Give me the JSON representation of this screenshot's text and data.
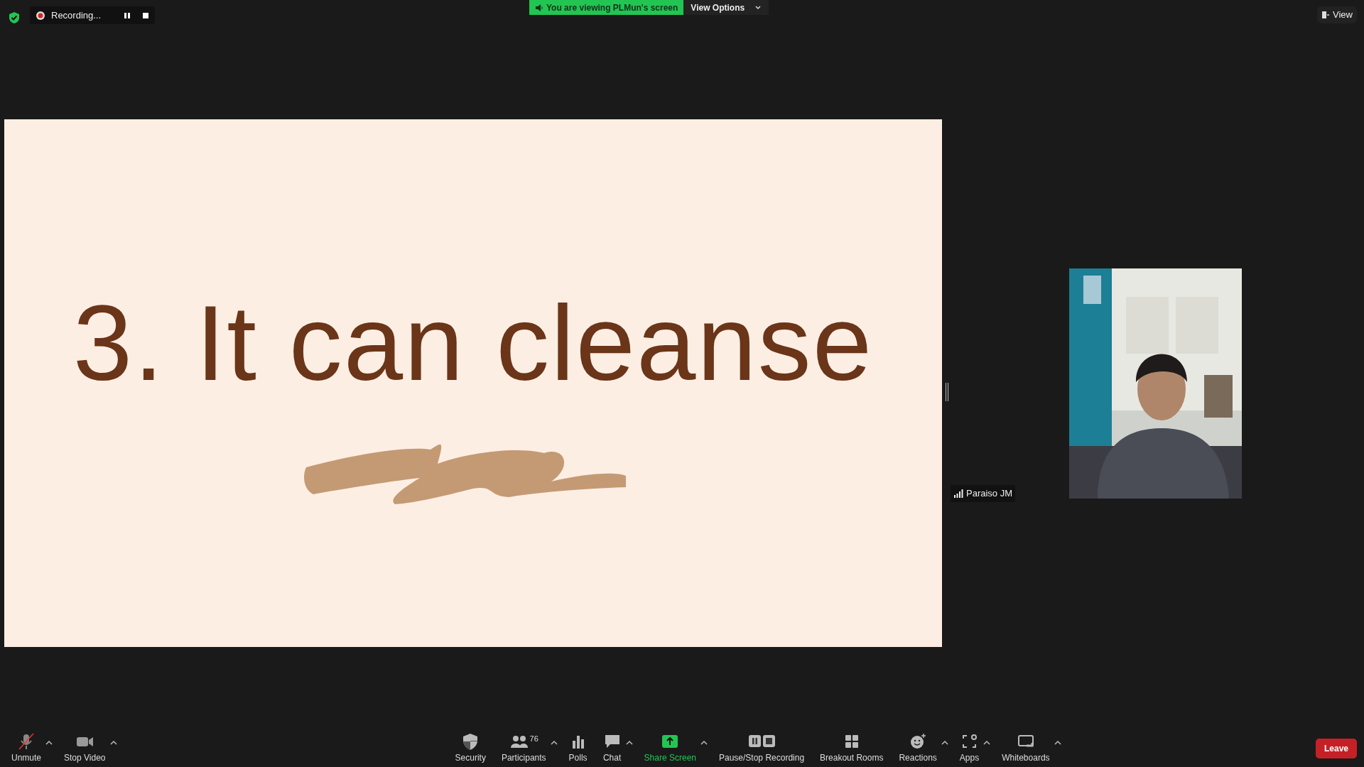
{
  "top_bar": {
    "recording": {
      "label": "Recording..."
    },
    "banner": "You are viewing PLMun's screen",
    "view_options": "View Options",
    "view_button": "View"
  },
  "slide": {
    "heading": "3. It can cleanse"
  },
  "participant": {
    "name": "Paraiso JM"
  },
  "toolbar_left": [
    {
      "kind": "mic-muted",
      "label": "Unmute",
      "caret": true
    },
    {
      "kind": "camera",
      "label": "Stop Video",
      "caret": true
    }
  ],
  "toolbar_center": [
    {
      "kind": "shield",
      "label": "Security",
      "caret": false
    },
    {
      "kind": "people",
      "label": "Participants",
      "caret": true,
      "count": "76"
    },
    {
      "kind": "bars",
      "label": "Polls",
      "caret": false
    },
    {
      "kind": "chat",
      "label": "Chat",
      "caret": true
    },
    {
      "kind": "share",
      "label": "Share Screen",
      "caret": true,
      "highlight": true
    },
    {
      "kind": "pause-stop",
      "label": "Pause/Stop Recording",
      "caret": false
    },
    {
      "kind": "grid",
      "label": "Breakout Rooms",
      "caret": false
    },
    {
      "kind": "smile",
      "label": "Reactions",
      "caret": true
    },
    {
      "kind": "apps",
      "label": "Apps",
      "caret": true
    },
    {
      "kind": "board",
      "label": "Whiteboards",
      "caret": true
    }
  ],
  "leave_button": "Leave"
}
